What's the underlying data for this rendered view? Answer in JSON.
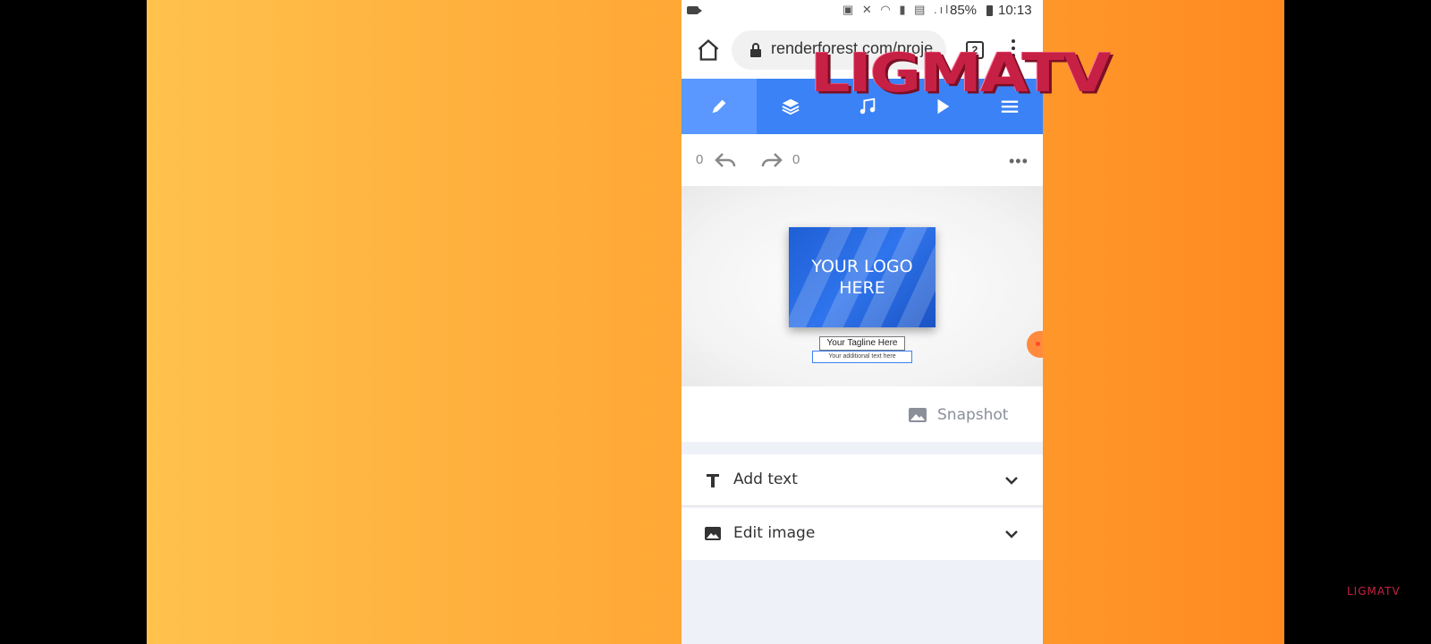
{
  "watermark": {
    "large": "LIGMATV",
    "small": "LIGMATV"
  },
  "status_bar": {
    "battery": "85%",
    "time": "10:13",
    "icons": "▣ ✕ ◠ ▮ ▤ .ıl"
  },
  "browser": {
    "url": "renderforest.com/proje",
    "tab_count": "2"
  },
  "toolbar": {
    "items": [
      {
        "name": "edit",
        "icon": "pencil-icon",
        "active": true
      },
      {
        "name": "layers",
        "icon": "layers-icon",
        "active": false
      },
      {
        "name": "music",
        "icon": "music-note-icon",
        "active": false
      },
      {
        "name": "play",
        "icon": "play-icon",
        "active": false
      },
      {
        "name": "menu",
        "icon": "hamburger-icon",
        "active": false
      }
    ],
    "accent": "#3b82f6"
  },
  "history": {
    "undo_count": "0",
    "redo_count": "0"
  },
  "preview": {
    "logo_text": "YOUR LOGO HERE",
    "tagline": "Your Tagline Here",
    "additional": "Your additional text here"
  },
  "snapshot": {
    "label": "Snapshot"
  },
  "accordion": [
    {
      "label": "Add text",
      "icon": "text-t-icon"
    },
    {
      "label": "Edit image",
      "icon": "image-icon"
    }
  ]
}
